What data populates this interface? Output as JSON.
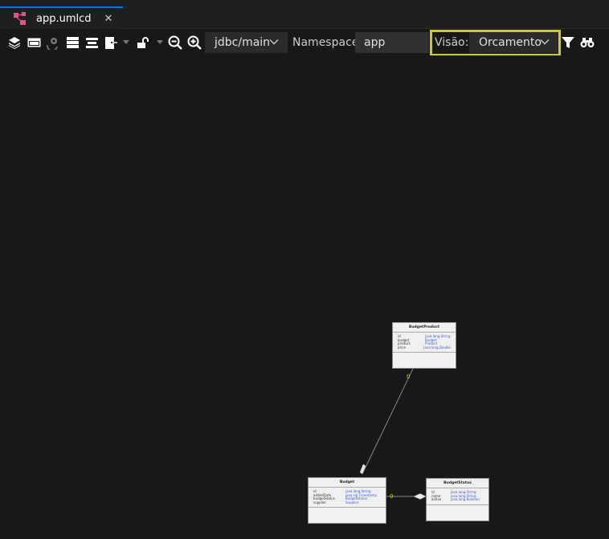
{
  "tab": {
    "label": "app.umlcd",
    "close": "✕"
  },
  "toolbar": {
    "branch": "jdbc/main",
    "namespace_label": "Namespace:",
    "namespace_value": "app",
    "visao_label": "Visão:",
    "visao_value": "Orcamento"
  },
  "diagram": {
    "classes": [
      {
        "name": "BudgetProduct",
        "attrs": [
          {
            "name": "id",
            "type": "java.lang.String"
          },
          {
            "name": "budget",
            "type": "Budget"
          },
          {
            "name": "product",
            "type": "Product"
          },
          {
            "name": "price",
            "type": "java.lang.Double"
          }
        ]
      },
      {
        "name": "Budget",
        "attrs": [
          {
            "name": "id",
            "type": "java.lang.String"
          },
          {
            "name": "addedDate",
            "type": "java.sql.Timestamp"
          },
          {
            "name": "budgetStatus",
            "type": "BudgetStatus"
          },
          {
            "name": "supplier",
            "type": "Supplier"
          }
        ]
      },
      {
        "name": "BudgetStatus",
        "attrs": [
          {
            "name": "id",
            "type": "java.lang.String"
          },
          {
            "name": "name",
            "type": "java.lang.String"
          },
          {
            "name": "active",
            "type": "java.lang.Boolean"
          }
        ]
      }
    ],
    "multiplicity_1": "0",
    "multiplicity_2": "0"
  }
}
